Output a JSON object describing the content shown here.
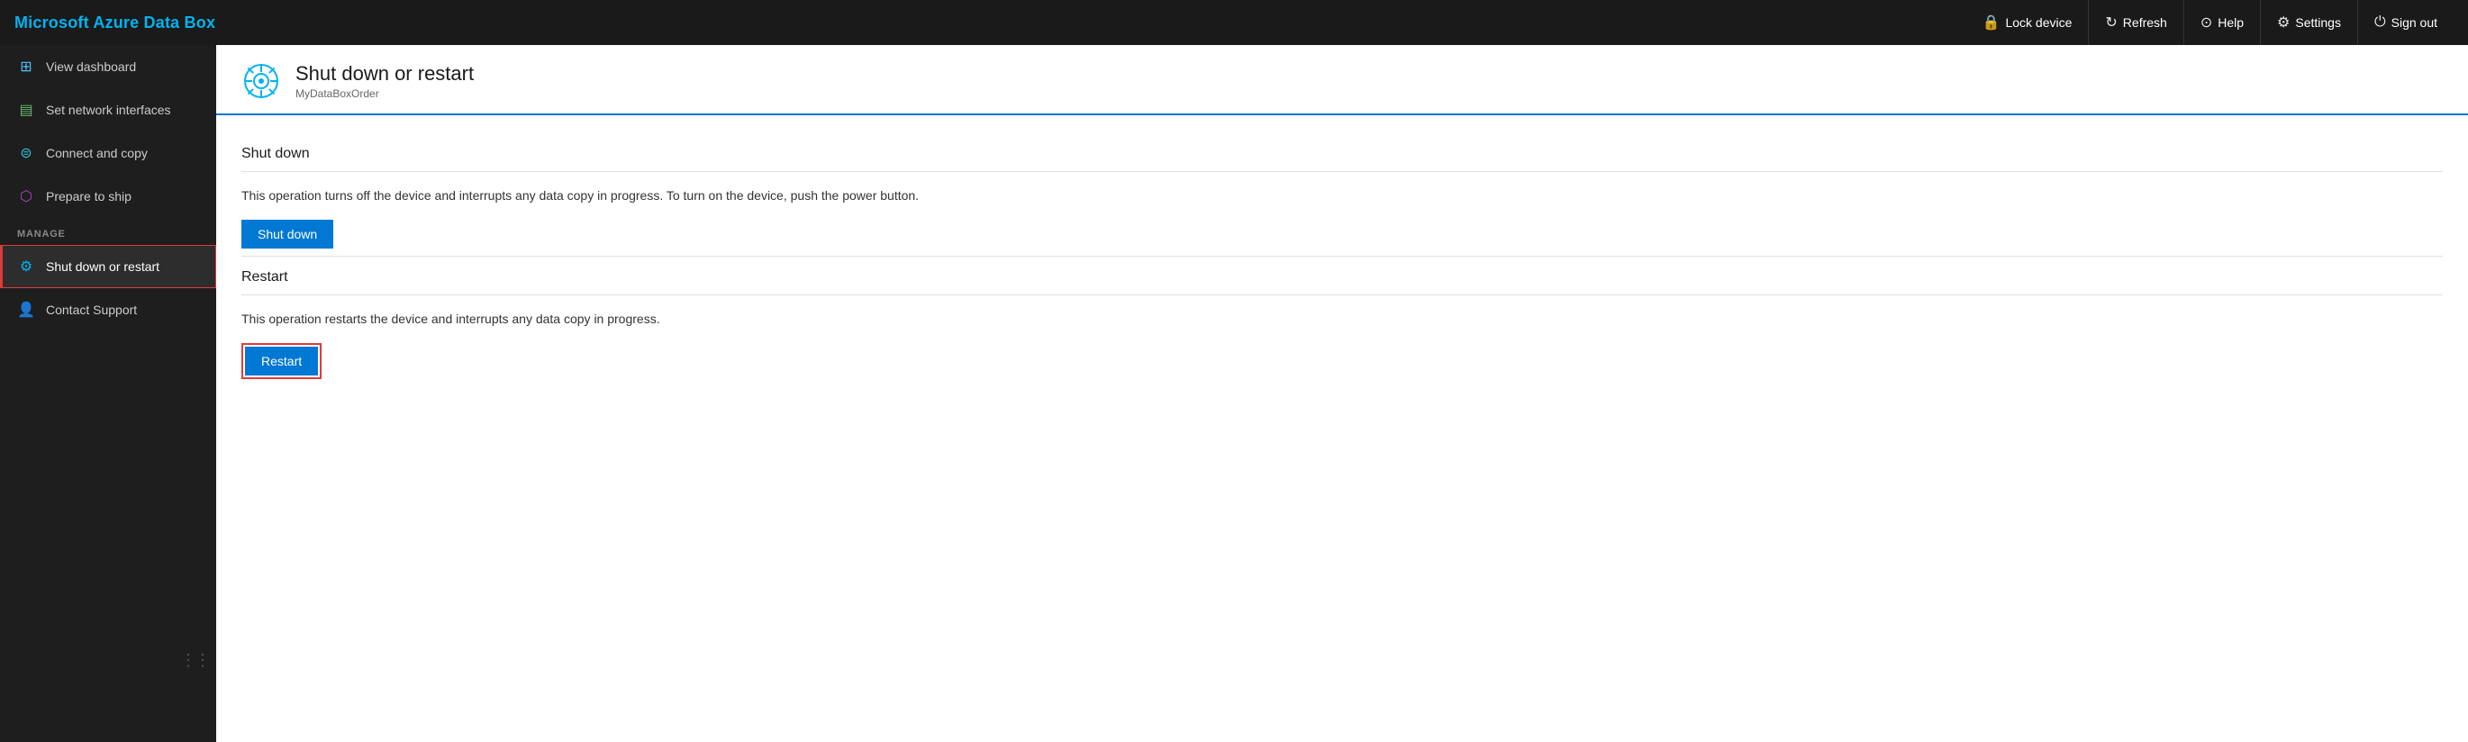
{
  "app": {
    "title": "Microsoft Azure Data Box"
  },
  "topnav": {
    "lock_label": "Lock device",
    "refresh_label": "Refresh",
    "help_label": "Help",
    "settings_label": "Settings",
    "signout_label": "Sign out"
  },
  "sidebar": {
    "items": [
      {
        "id": "dashboard",
        "label": "View dashboard",
        "icon": "grid"
      },
      {
        "id": "network",
        "label": "Set network interfaces",
        "icon": "network"
      },
      {
        "id": "copy",
        "label": "Connect and copy",
        "icon": "copy"
      },
      {
        "id": "ship",
        "label": "Prepare to ship",
        "icon": "ship"
      }
    ],
    "manage_label": "MANAGE",
    "manage_items": [
      {
        "id": "shutdown",
        "label": "Shut down or restart",
        "icon": "gear",
        "active": true
      },
      {
        "id": "support",
        "label": "Contact Support",
        "icon": "support"
      }
    ]
  },
  "page": {
    "title": "Shut down or restart",
    "subtitle": "MyDataBoxOrder",
    "shutdown_section": {
      "title": "Shut down",
      "description": "This operation turns off the device and interrupts any data copy in progress. To turn on the device, push the power button.",
      "button_label": "Shut down"
    },
    "restart_section": {
      "title": "Restart",
      "description": "This operation restarts the device and interrupts any data copy in progress.",
      "button_label": "Restart"
    }
  }
}
